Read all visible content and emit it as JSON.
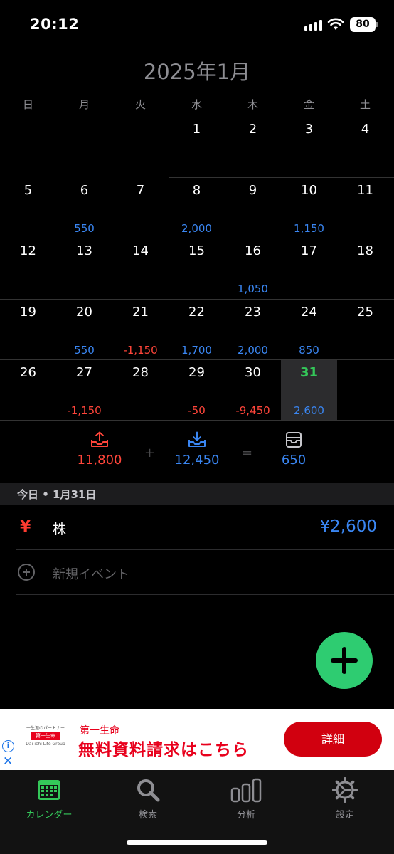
{
  "status": {
    "time": "20:12",
    "battery": "80"
  },
  "month_title": "2025年1月",
  "weekdays": [
    "日",
    "月",
    "火",
    "水",
    "木",
    "金",
    "土"
  ],
  "weeks": [
    [
      {
        "d": "",
        "a": ""
      },
      {
        "d": "",
        "a": ""
      },
      {
        "d": "",
        "a": ""
      },
      {
        "d": "1",
        "a": ""
      },
      {
        "d": "2",
        "a": ""
      },
      {
        "d": "3",
        "a": ""
      },
      {
        "d": "4",
        "a": ""
      }
    ],
    [
      {
        "d": "5",
        "a": ""
      },
      {
        "d": "6",
        "a": "550"
      },
      {
        "d": "7",
        "a": ""
      },
      {
        "d": "8",
        "a": "2,000"
      },
      {
        "d": "9",
        "a": ""
      },
      {
        "d": "10",
        "a": "1,150"
      },
      {
        "d": "11",
        "a": ""
      }
    ],
    [
      {
        "d": "12",
        "a": ""
      },
      {
        "d": "13",
        "a": ""
      },
      {
        "d": "14",
        "a": ""
      },
      {
        "d": "15",
        "a": ""
      },
      {
        "d": "16",
        "a": "1,050"
      },
      {
        "d": "17",
        "a": ""
      },
      {
        "d": "18",
        "a": ""
      }
    ],
    [
      {
        "d": "19",
        "a": ""
      },
      {
        "d": "20",
        "a": "550"
      },
      {
        "d": "21",
        "a": "-1,150"
      },
      {
        "d": "22",
        "a": "1,700"
      },
      {
        "d": "23",
        "a": "2,000"
      },
      {
        "d": "24",
        "a": "850"
      },
      {
        "d": "25",
        "a": ""
      }
    ],
    [
      {
        "d": "26",
        "a": ""
      },
      {
        "d": "27",
        "a": "-1,150"
      },
      {
        "d": "28",
        "a": ""
      },
      {
        "d": "29",
        "a": "-50"
      },
      {
        "d": "30",
        "a": "-9,450"
      },
      {
        "d": "31",
        "a": "2,600",
        "today": true
      },
      {
        "d": "",
        "a": ""
      }
    ]
  ],
  "summary": {
    "expense": "11,800",
    "plus": "+",
    "income": "12,450",
    "equals": "=",
    "balance": "650"
  },
  "today_section": {
    "label": "今日 • 1月31日",
    "event": {
      "icon": "¥",
      "name": "株",
      "amount": "¥2,600"
    },
    "new_event_label": "新規イベント"
  },
  "ad": {
    "logo_tag": "一生涯のパートナー",
    "logo_name": "第一生命",
    "logo_sub": "Dai-ichi Life Group",
    "brand": "第一生命",
    "headline": "無料資料請求はこちら",
    "button": "詳細",
    "info": "i",
    "close": "✕"
  },
  "tabs": [
    {
      "label": "カレンダー",
      "icon": "calendar-icon",
      "active": true
    },
    {
      "label": "検索",
      "icon": "search-icon"
    },
    {
      "label": "分析",
      "icon": "chart-icon"
    },
    {
      "label": "設定",
      "icon": "gear-icon"
    }
  ],
  "colors": {
    "accent_green": "#34c759",
    "income_blue": "#3a86f2",
    "expense_red": "#ff453a",
    "fab": "#2ecc71"
  }
}
